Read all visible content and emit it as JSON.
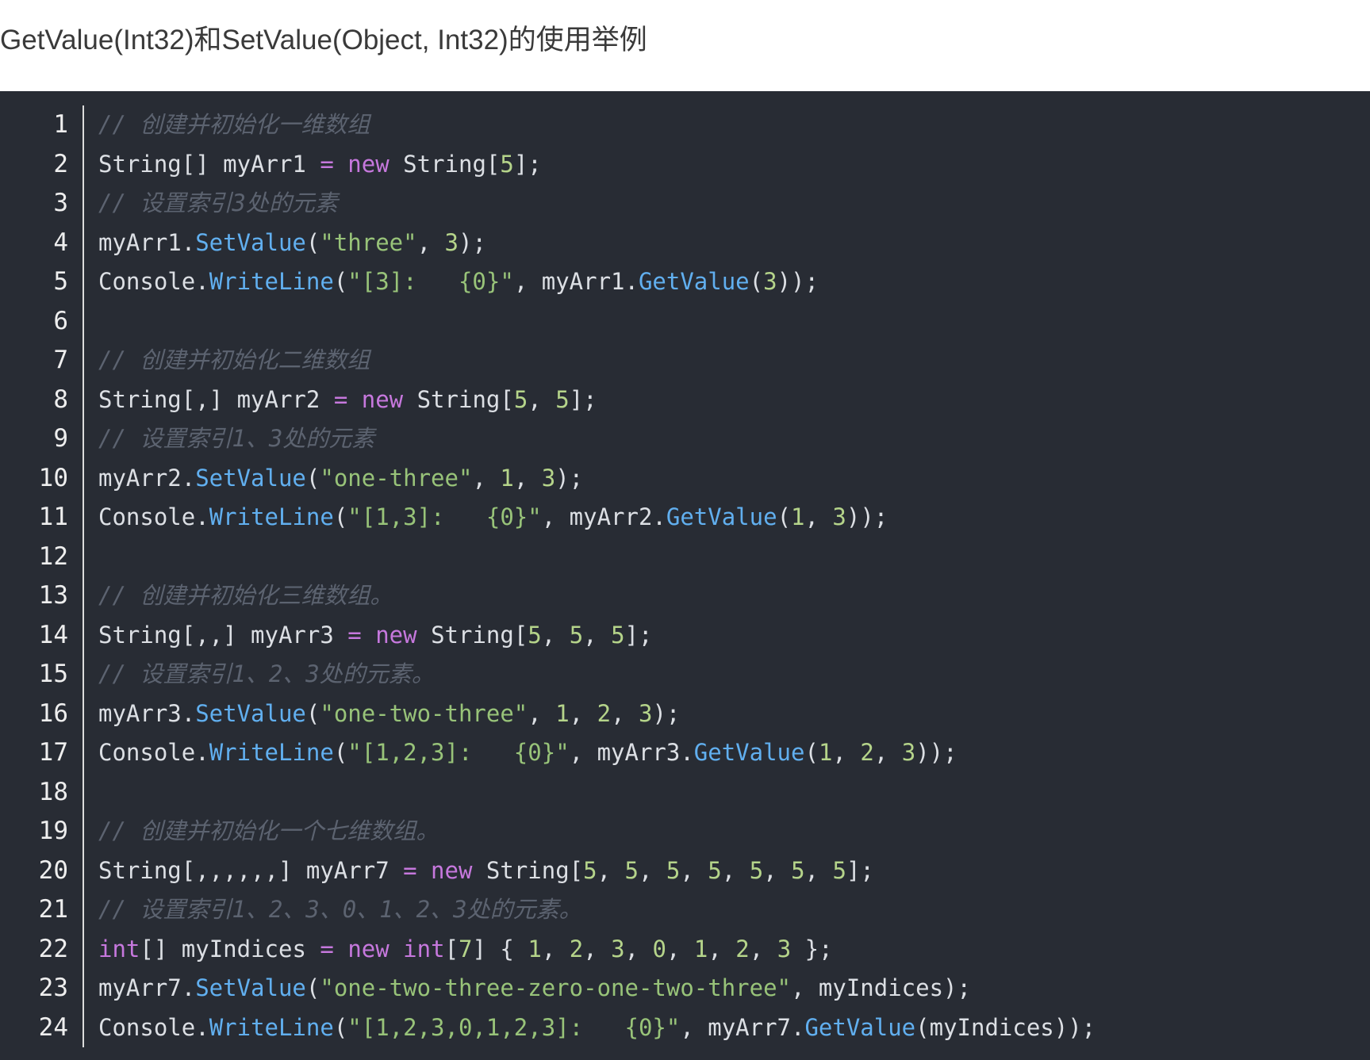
{
  "page": {
    "title": "GetValue(Int32)和SetValue(Object, Int32)的使用举例"
  },
  "colors": {
    "code_background": "#282c34",
    "comment": "#5c6370",
    "keyword": "#c678dd",
    "method": "#61afef",
    "string": "#98c379",
    "number": "#b5d48a",
    "plain": "#dcdfe4"
  },
  "code": {
    "language": "C#",
    "lines": [
      {
        "n": "1",
        "tokens": [
          {
            "t": "comment",
            "v": "// 创建并初始化一维数组"
          }
        ]
      },
      {
        "n": "2",
        "tokens": [
          {
            "t": "plain",
            "v": "String[] myArr1 "
          },
          {
            "t": "keyword",
            "v": "="
          },
          {
            "t": "plain",
            "v": " "
          },
          {
            "t": "keyword",
            "v": "new"
          },
          {
            "t": "plain",
            "v": " String["
          },
          {
            "t": "number",
            "v": "5"
          },
          {
            "t": "plain",
            "v": "];"
          }
        ]
      },
      {
        "n": "3",
        "tokens": [
          {
            "t": "comment",
            "v": "// 设置索引3处的元素"
          }
        ]
      },
      {
        "n": "4",
        "tokens": [
          {
            "t": "plain",
            "v": "myArr1."
          },
          {
            "t": "method",
            "v": "SetValue"
          },
          {
            "t": "plain",
            "v": "("
          },
          {
            "t": "string",
            "v": "\"three\""
          },
          {
            "t": "plain",
            "v": ", "
          },
          {
            "t": "number",
            "v": "3"
          },
          {
            "t": "plain",
            "v": ");"
          }
        ]
      },
      {
        "n": "5",
        "tokens": [
          {
            "t": "plain",
            "v": "Console."
          },
          {
            "t": "method",
            "v": "WriteLine"
          },
          {
            "t": "plain",
            "v": "("
          },
          {
            "t": "string",
            "v": "\"[3]:   {0}\""
          },
          {
            "t": "plain",
            "v": ", myArr1."
          },
          {
            "t": "method",
            "v": "GetValue"
          },
          {
            "t": "plain",
            "v": "("
          },
          {
            "t": "number",
            "v": "3"
          },
          {
            "t": "plain",
            "v": "));"
          }
        ]
      },
      {
        "n": "6",
        "tokens": []
      },
      {
        "n": "7",
        "tokens": [
          {
            "t": "comment",
            "v": "// 创建并初始化二维数组"
          }
        ]
      },
      {
        "n": "8",
        "tokens": [
          {
            "t": "plain",
            "v": "String[,] myArr2 "
          },
          {
            "t": "keyword",
            "v": "="
          },
          {
            "t": "plain",
            "v": " "
          },
          {
            "t": "keyword",
            "v": "new"
          },
          {
            "t": "plain",
            "v": " String["
          },
          {
            "t": "number",
            "v": "5"
          },
          {
            "t": "plain",
            "v": ", "
          },
          {
            "t": "number",
            "v": "5"
          },
          {
            "t": "plain",
            "v": "];"
          }
        ]
      },
      {
        "n": "9",
        "tokens": [
          {
            "t": "comment",
            "v": "// 设置索引1、3处的元素"
          }
        ]
      },
      {
        "n": "10",
        "tokens": [
          {
            "t": "plain",
            "v": "myArr2."
          },
          {
            "t": "method",
            "v": "SetValue"
          },
          {
            "t": "plain",
            "v": "("
          },
          {
            "t": "string",
            "v": "\"one-three\""
          },
          {
            "t": "plain",
            "v": ", "
          },
          {
            "t": "number",
            "v": "1"
          },
          {
            "t": "plain",
            "v": ", "
          },
          {
            "t": "number",
            "v": "3"
          },
          {
            "t": "plain",
            "v": ");"
          }
        ]
      },
      {
        "n": "11",
        "tokens": [
          {
            "t": "plain",
            "v": "Console."
          },
          {
            "t": "method",
            "v": "WriteLine"
          },
          {
            "t": "plain",
            "v": "("
          },
          {
            "t": "string",
            "v": "\"[1,3]:   {0}\""
          },
          {
            "t": "plain",
            "v": ", myArr2."
          },
          {
            "t": "method",
            "v": "GetValue"
          },
          {
            "t": "plain",
            "v": "("
          },
          {
            "t": "number",
            "v": "1"
          },
          {
            "t": "plain",
            "v": ", "
          },
          {
            "t": "number",
            "v": "3"
          },
          {
            "t": "plain",
            "v": "));"
          }
        ]
      },
      {
        "n": "12",
        "tokens": []
      },
      {
        "n": "13",
        "tokens": [
          {
            "t": "comment",
            "v": "// 创建并初始化三维数组。"
          }
        ]
      },
      {
        "n": "14",
        "tokens": [
          {
            "t": "plain",
            "v": "String[,,] myArr3 "
          },
          {
            "t": "keyword",
            "v": "="
          },
          {
            "t": "plain",
            "v": " "
          },
          {
            "t": "keyword",
            "v": "new"
          },
          {
            "t": "plain",
            "v": " String["
          },
          {
            "t": "number",
            "v": "5"
          },
          {
            "t": "plain",
            "v": ", "
          },
          {
            "t": "number",
            "v": "5"
          },
          {
            "t": "plain",
            "v": ", "
          },
          {
            "t": "number",
            "v": "5"
          },
          {
            "t": "plain",
            "v": "];"
          }
        ]
      },
      {
        "n": "15",
        "tokens": [
          {
            "t": "comment",
            "v": "// 设置索引1、2、3处的元素。"
          }
        ]
      },
      {
        "n": "16",
        "tokens": [
          {
            "t": "plain",
            "v": "myArr3."
          },
          {
            "t": "method",
            "v": "SetValue"
          },
          {
            "t": "plain",
            "v": "("
          },
          {
            "t": "string",
            "v": "\"one-two-three\""
          },
          {
            "t": "plain",
            "v": ", "
          },
          {
            "t": "number",
            "v": "1"
          },
          {
            "t": "plain",
            "v": ", "
          },
          {
            "t": "number",
            "v": "2"
          },
          {
            "t": "plain",
            "v": ", "
          },
          {
            "t": "number",
            "v": "3"
          },
          {
            "t": "plain",
            "v": ");"
          }
        ]
      },
      {
        "n": "17",
        "tokens": [
          {
            "t": "plain",
            "v": "Console."
          },
          {
            "t": "method",
            "v": "WriteLine"
          },
          {
            "t": "plain",
            "v": "("
          },
          {
            "t": "string",
            "v": "\"[1,2,3]:   {0}\""
          },
          {
            "t": "plain",
            "v": ", myArr3."
          },
          {
            "t": "method",
            "v": "GetValue"
          },
          {
            "t": "plain",
            "v": "("
          },
          {
            "t": "number",
            "v": "1"
          },
          {
            "t": "plain",
            "v": ", "
          },
          {
            "t": "number",
            "v": "2"
          },
          {
            "t": "plain",
            "v": ", "
          },
          {
            "t": "number",
            "v": "3"
          },
          {
            "t": "plain",
            "v": "));"
          }
        ]
      },
      {
        "n": "18",
        "tokens": []
      },
      {
        "n": "19",
        "tokens": [
          {
            "t": "comment",
            "v": "// 创建并初始化一个七维数组。"
          }
        ]
      },
      {
        "n": "20",
        "tokens": [
          {
            "t": "plain",
            "v": "String[,,,,,,] myArr7 "
          },
          {
            "t": "keyword",
            "v": "="
          },
          {
            "t": "plain",
            "v": " "
          },
          {
            "t": "keyword",
            "v": "new"
          },
          {
            "t": "plain",
            "v": " String["
          },
          {
            "t": "number",
            "v": "5"
          },
          {
            "t": "plain",
            "v": ", "
          },
          {
            "t": "number",
            "v": "5"
          },
          {
            "t": "plain",
            "v": ", "
          },
          {
            "t": "number",
            "v": "5"
          },
          {
            "t": "plain",
            "v": ", "
          },
          {
            "t": "number",
            "v": "5"
          },
          {
            "t": "plain",
            "v": ", "
          },
          {
            "t": "number",
            "v": "5"
          },
          {
            "t": "plain",
            "v": ", "
          },
          {
            "t": "number",
            "v": "5"
          },
          {
            "t": "plain",
            "v": ", "
          },
          {
            "t": "number",
            "v": "5"
          },
          {
            "t": "plain",
            "v": "];"
          }
        ]
      },
      {
        "n": "21",
        "tokens": [
          {
            "t": "comment",
            "v": "// 设置索引1、2、3、0、1、2、3处的元素。"
          }
        ]
      },
      {
        "n": "22",
        "tokens": [
          {
            "t": "keyword",
            "v": "int"
          },
          {
            "t": "plain",
            "v": "[] myIndices "
          },
          {
            "t": "keyword",
            "v": "="
          },
          {
            "t": "plain",
            "v": " "
          },
          {
            "t": "keyword",
            "v": "new"
          },
          {
            "t": "plain",
            "v": " "
          },
          {
            "t": "keyword",
            "v": "int"
          },
          {
            "t": "plain",
            "v": "["
          },
          {
            "t": "number",
            "v": "7"
          },
          {
            "t": "plain",
            "v": "] { "
          },
          {
            "t": "number",
            "v": "1"
          },
          {
            "t": "plain",
            "v": ", "
          },
          {
            "t": "number",
            "v": "2"
          },
          {
            "t": "plain",
            "v": ", "
          },
          {
            "t": "number",
            "v": "3"
          },
          {
            "t": "plain",
            "v": ", "
          },
          {
            "t": "number",
            "v": "0"
          },
          {
            "t": "plain",
            "v": ", "
          },
          {
            "t": "number",
            "v": "1"
          },
          {
            "t": "plain",
            "v": ", "
          },
          {
            "t": "number",
            "v": "2"
          },
          {
            "t": "plain",
            "v": ", "
          },
          {
            "t": "number",
            "v": "3"
          },
          {
            "t": "plain",
            "v": " };"
          }
        ]
      },
      {
        "n": "23",
        "tokens": [
          {
            "t": "plain",
            "v": "myArr7."
          },
          {
            "t": "method",
            "v": "SetValue"
          },
          {
            "t": "plain",
            "v": "("
          },
          {
            "t": "string",
            "v": "\"one-two-three-zero-one-two-three\""
          },
          {
            "t": "plain",
            "v": ", myIndices);"
          }
        ]
      },
      {
        "n": "24",
        "tokens": [
          {
            "t": "plain",
            "v": "Console."
          },
          {
            "t": "method",
            "v": "WriteLine"
          },
          {
            "t": "plain",
            "v": "("
          },
          {
            "t": "string",
            "v": "\"[1,2,3,0,1,2,3]:   {0}\""
          },
          {
            "t": "plain",
            "v": ", myArr7."
          },
          {
            "t": "method",
            "v": "GetValue"
          },
          {
            "t": "plain",
            "v": "(myIndices));"
          }
        ]
      }
    ]
  }
}
